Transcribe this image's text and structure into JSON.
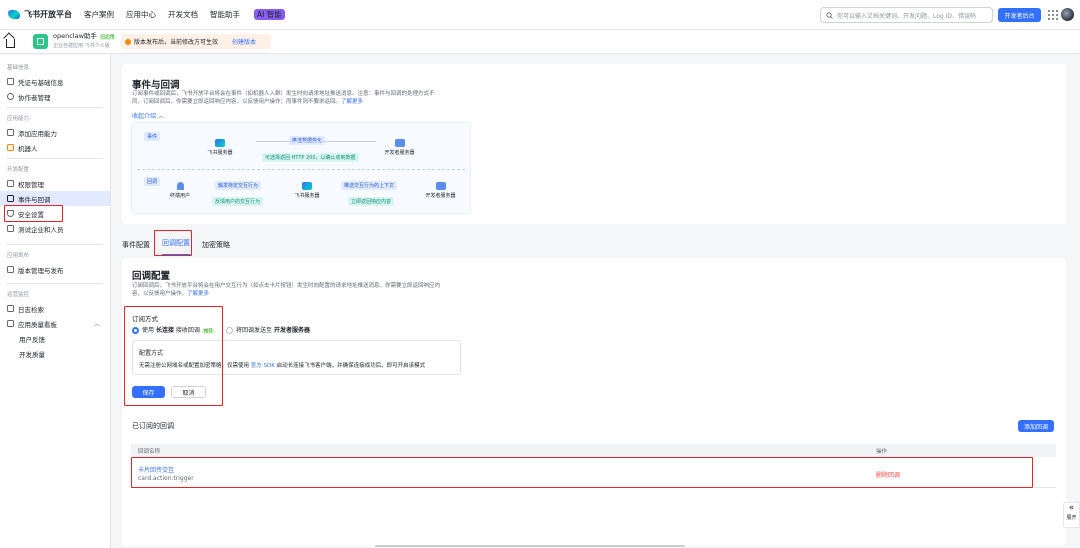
{
  "topnav": {
    "brand": "飞书开放平台",
    "links": [
      "客户案例",
      "应用中心",
      "开发文档",
      "智能助手"
    ],
    "ai_badge": "AI 智能",
    "search_placeholder": "你可以输入文档关键词、开发问题、Log ID、错误码",
    "dev_console": "开发者后台"
  },
  "app": {
    "name": "openclaw助手",
    "status": "已启用",
    "subtitle": "企业自建应用·飞书个人版",
    "notice": "版本发布后，当前修改方可生效",
    "notice_link": "创建版本"
  },
  "sidebar": {
    "groups": [
      {
        "title": "基础信息",
        "items": [
          "凭证与基础信息",
          "协作者管理"
        ]
      },
      {
        "title": "应用能力",
        "items": [
          "添加应用能力",
          "机器人"
        ]
      },
      {
        "title": "开发配置",
        "items": [
          "权限管理",
          "事件与回调",
          "安全设置",
          "测试企业和人员"
        ]
      },
      {
        "title": "应用发布",
        "items": [
          "版本管理与发布"
        ]
      },
      {
        "title": "运营监控",
        "items": [
          "日志检索",
          "应用质量看板"
        ],
        "sub_items": [
          "用户反馈",
          "开发质量"
        ]
      }
    ]
  },
  "events_intro": {
    "title": "事件与回调",
    "desc_line1": "订阅事件或回调后，飞书开放平台将会在事件（如机器人入群）发生时向请求地址推送消息。注意：事件与回调的处理方式不",
    "desc_line2": "同，订阅回调后，你需要立即返回响应内容，以反馈用户操作；而事件则不要求返回。",
    "learn_more": "了解更多",
    "collapse": "收起介绍",
    "diagram": {
      "event_tag": "事件",
      "callback_tag": "回调",
      "feishu_server": "飞书服务器",
      "dev_server": "开发者服务器",
      "end_user": "终端用户",
      "push_change": "推送数据变化",
      "ack_200": "可选择返回 HTTP 200，以确认收到数据",
      "trigger_action": "触发特定交互行为",
      "feedback_action": "反馈用户的交互行为",
      "push_context": "推送交互行为的上下文",
      "return_response": "立即返回响应内容"
    }
  },
  "tabs": [
    "事件配置",
    "回调配置",
    "加密策略"
  ],
  "callback": {
    "title": "回调配置",
    "desc_line1": "订阅回调后，飞书开放平台将会在用户交互行为（如点击卡片按钮）发生时向配置的请求地址推送消息。你需要立即返回响应内",
    "desc_line2": "容，以反馈用户操作。",
    "learn_more": "了解更多",
    "subscribe_mode_label": "订阅方式",
    "option_long_prefix": "使用",
    "option_long_strong": "长连接",
    "option_long_suffix": "接收回调",
    "recommended": "推荐",
    "option_http_prefix": "将回调发送至",
    "option_http_strong": "开发者服务器",
    "config_title": "配置方式",
    "config_desc_pre": "无需注册公网域名或配置加密策略，仅需使用",
    "config_link": "官方 SDK",
    "config_desc_post": "启动长连接飞书客户端，并确保连接成功后，即可开启该模式",
    "save": "保存",
    "cancel": "取消",
    "subscribed_title": "已订阅的回调",
    "add_callback": "添加回调",
    "col_name": "回调名称",
    "col_action": "操作",
    "rows": [
      {
        "name": "卡片回传交互",
        "key": "card.action.trigger",
        "action": "删除回调"
      }
    ]
  },
  "side_expand": "展开"
}
